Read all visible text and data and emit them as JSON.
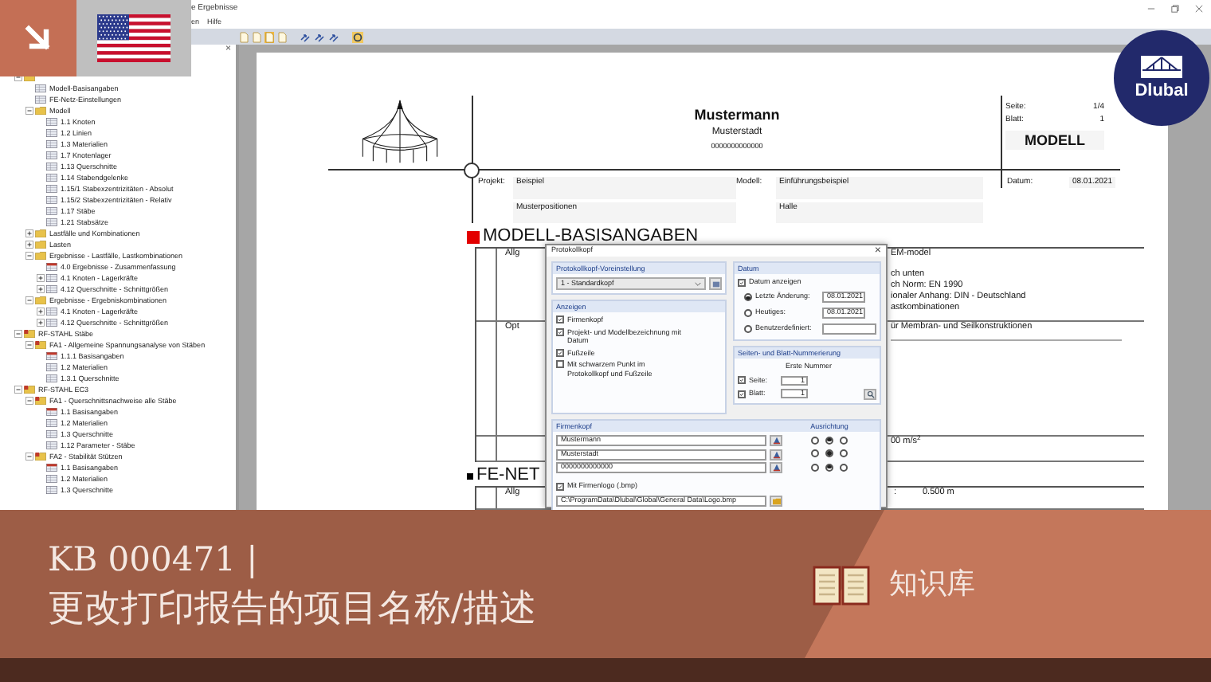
{
  "window": {
    "title": "e Ergebnisse",
    "menu": [
      "en",
      "Hilfe"
    ]
  },
  "navigator": {
    "close": "×",
    "items": [
      {
        "kind": "folder",
        "expanded": true,
        "children": [
          {
            "label": "Modell-Basisangaben",
            "kind": "table"
          },
          {
            "label": "FE-Netz-Einstellungen",
            "kind": "table"
          },
          {
            "label": "Modell",
            "kind": "folder",
            "expanded": true,
            "children": [
              {
                "label": "1.1 Knoten",
                "kind": "table"
              },
              {
                "label": "1.2 Linien",
                "kind": "table"
              },
              {
                "label": "1.3 Materialien",
                "kind": "table"
              },
              {
                "label": "1.7 Knotenlager",
                "kind": "table"
              },
              {
                "label": "1.13 Querschnitte",
                "kind": "table"
              },
              {
                "label": "1.14 Stabendgelenke",
                "kind": "table"
              },
              {
                "label": "1.15/1 Stabexzentrizitäten - Absolut",
                "kind": "table"
              },
              {
                "label": "1.15/2 Stabexzentrizitäten - Relativ",
                "kind": "table"
              },
              {
                "label": "1.17 Stäbe",
                "kind": "table"
              },
              {
                "label": "1.21 Stabsätze",
                "kind": "table"
              }
            ]
          },
          {
            "label": "Lastfälle und Kombinationen",
            "kind": "folder",
            "expanded": false
          },
          {
            "label": "Lasten",
            "kind": "folder",
            "expanded": false
          },
          {
            "label": "Ergebnisse - Lastfälle, Lastkombinationen",
            "kind": "folder",
            "expanded": true,
            "children": [
              {
                "label": "4.0 Ergebnisse - Zusammenfassung",
                "kind": "summary"
              },
              {
                "label": "4.1 Knoten - Lagerkräfte",
                "kind": "table",
                "expanded": false
              },
              {
                "label": "4.12 Querschnitte - Schnittgrößen",
                "kind": "table",
                "expanded": false
              }
            ]
          },
          {
            "label": "Ergebnisse - Ergebniskombinationen",
            "kind": "folder",
            "expanded": true,
            "children": [
              {
                "label": "4.1 Knoten - Lagerkräfte",
                "kind": "table",
                "expanded": false
              },
              {
                "label": "4.12 Querschnitte - Schnittgrößen",
                "kind": "table",
                "expanded": false
              }
            ]
          }
        ]
      },
      {
        "label": "RF-STAHL Stäbe",
        "kind": "module",
        "expanded": true,
        "children": [
          {
            "label": "FA1 - Allgemeine Spannungsanalyse von Stäben",
            "kind": "module",
            "expanded": true,
            "children": [
              {
                "label": "1.1.1 Basisangaben",
                "kind": "summary"
              },
              {
                "label": "1.2 Materialien",
                "kind": "table"
              },
              {
                "label": "1.3.1 Querschnitte",
                "kind": "table"
              }
            ]
          }
        ]
      },
      {
        "label": "RF-STAHL EC3",
        "kind": "module",
        "expanded": true,
        "children": [
          {
            "label": "FA1 - Querschnittsnachweise alle Stäbe",
            "kind": "module",
            "expanded": true,
            "children": [
              {
                "label": "1.1 Basisangaben",
                "kind": "summary"
              },
              {
                "label": "1.2 Materialien",
                "kind": "table"
              },
              {
                "label": "1.3 Querschnitte",
                "kind": "table"
              },
              {
                "label": "1.12 Parameter - Stäbe",
                "kind": "table"
              }
            ]
          },
          {
            "label": "FA2 - Stabilität Stützen",
            "kind": "module",
            "expanded": true,
            "children": [
              {
                "label": "1.1 Basisangaben",
                "kind": "summary"
              },
              {
                "label": "1.2 Materialien",
                "kind": "table"
              },
              {
                "label": "1.3 Querschnitte",
                "kind": "table"
              }
            ]
          }
        ]
      }
    ]
  },
  "report": {
    "company": "Mustermann",
    "city": "Musterstadt",
    "phone": "0000000000000",
    "page_label": "Seite:",
    "page": "1/4",
    "sheet_label": "Blatt:",
    "sheet": "1",
    "title": "MODELL",
    "project_label": "Projekt:",
    "project": "Beispiel",
    "project_detail": "Musterpositionen",
    "model_label": "Modell:",
    "model": "Einführungsbeispiel",
    "model_detail": "Halle",
    "date_label": "Datum:",
    "date": "08.01.2021",
    "sections": [
      {
        "kind": "chapter",
        "heading": "MODELL-BASISANGABEN",
        "rows": [
          {
            "label": "Allg",
            "values": [
              "EM-model",
              "ch unten",
              "ch Norm: EN 1990",
              "ionaler Anhang: DIN - Deutschland",
              "astkombinationen"
            ]
          },
          {
            "label": "Opt",
            "values": [
              "ür Membran- und Seilkonstruktionen"
            ]
          },
          {
            "values": [
              "00 m/s$^{2}$"
            ]
          }
        ]
      },
      {
        "kind": "subchapter",
        "heading": "FE-NET",
        "rows": [
          {
            "label": "Allg",
            "sep": ":",
            "values": [
              "0.500 m"
            ]
          }
        ]
      }
    ]
  },
  "dialog": {
    "title": "Protokollkopf",
    "close": "×",
    "preset": {
      "heading": "Protokollkopf-Voreinstellung",
      "value": "1 - Standardkopf"
    },
    "display": {
      "heading": "Anzeigen",
      "options": [
        {
          "label": "Firmenkopf",
          "checked": true
        },
        {
          "label": "Projekt- und Modellbezeichnung mit Datum",
          "checked": true
        },
        {
          "label": "Fußzeile",
          "checked": true
        },
        {
          "label": "Mit schwarzem Punkt im Protokollkopf und Fußzeile",
          "checked": false
        }
      ]
    },
    "date": {
      "heading": "Datum",
      "show": {
        "label": "Datum anzeigen",
        "checked": true
      },
      "options": [
        {
          "label": "Letzte Änderung:",
          "selected": true,
          "value": "08.01.2021"
        },
        {
          "label": "Heutiges:",
          "selected": false,
          "value": "08.01.2021"
        },
        {
          "label": "Benutzerdefiniert:",
          "selected": false
        }
      ]
    },
    "numbering": {
      "heading": "Seiten- und Blatt-Nummerierung",
      "caption": "Erste Nummer",
      "rows": [
        {
          "label": "Seite:",
          "checked": true,
          "value": "1"
        },
        {
          "label": "Blatt:",
          "checked": true,
          "value": "1"
        }
      ]
    },
    "company": {
      "heading": "Firmenkopf",
      "alignment_heading": "Ausrichtung",
      "lines": [
        {
          "value": "Mustermann",
          "alignment": [
            {
              "selected": false
            },
            {
              "selected": true
            },
            {
              "selected": false
            }
          ]
        },
        {
          "value": "Musterstadt",
          "alignment": [
            {
              "selected": false
            },
            {
              "selected": true
            },
            {
              "selected": false
            }
          ]
        },
        {
          "value": "0000000000000",
          "alignment": [
            {
              "selected": false
            },
            {
              "selected": true
            },
            {
              "selected": false
            }
          ]
        }
      ],
      "logo": {
        "label": "Mit Firmenlogo (.bmp)",
        "checked": true
      },
      "logo_path": "C:\\ProgramData\\Dlubal\\Global\\General Data\\Logo.bmp"
    }
  },
  "brand": {
    "name": "Dlubal"
  },
  "banner": {
    "code": "KB 000471 |",
    "title": "更改打印报告的项目名称/描述",
    "section": "知识库"
  }
}
